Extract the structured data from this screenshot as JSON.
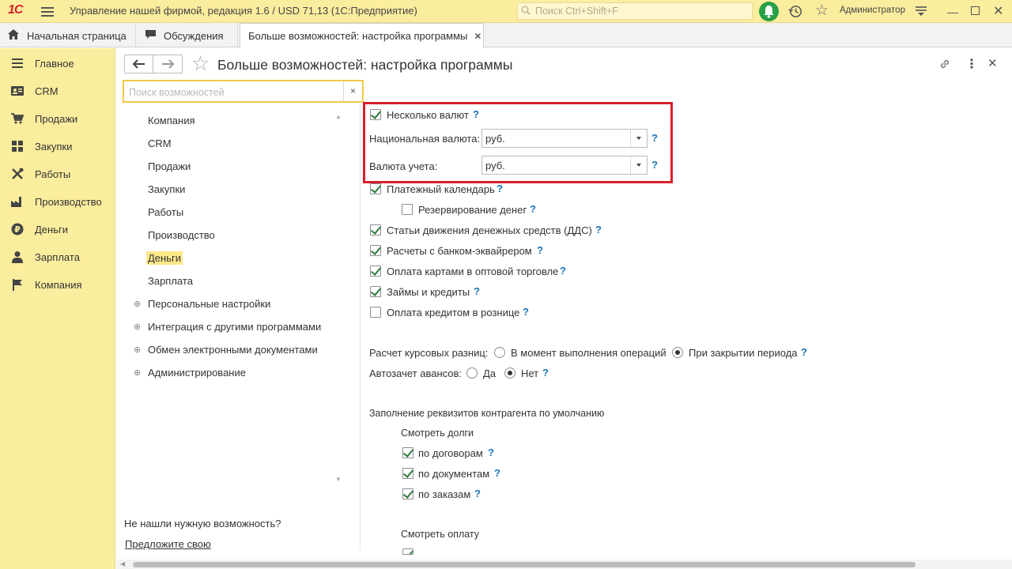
{
  "titlebar": {
    "logo": "1С",
    "app_title": "Управление нашей фирмой, редакция 1.6 / USD 71,13  (1С:Предприятие)",
    "search_placeholder": "Поиск Ctrl+Shift+F",
    "user": "Администратор"
  },
  "tabs": [
    {
      "label": "Начальная страница",
      "icon": "home-icon"
    },
    {
      "label": "Обсуждения",
      "icon": "chat-icon"
    },
    {
      "label": "Больше возможностей: настройка программы",
      "active": true
    }
  ],
  "sidebar": {
    "items": [
      {
        "label": "Главное",
        "icon": "menu-icon"
      },
      {
        "label": "CRM",
        "icon": "crm-card-icon"
      },
      {
        "label": "Продажи",
        "icon": "cart-icon"
      },
      {
        "label": "Закупки",
        "icon": "warehouse-icon"
      },
      {
        "label": "Работы",
        "icon": "tools-icon"
      },
      {
        "label": "Производство",
        "icon": "factory-icon"
      },
      {
        "label": "Деньги",
        "icon": "ruble-coin-icon"
      },
      {
        "label": "Зарплата",
        "icon": "person-icon"
      },
      {
        "label": "Компания",
        "icon": "flag-icon"
      }
    ]
  },
  "form": {
    "title": "Больше возможностей: настройка программы",
    "search_placeholder": "Поиск возможностей",
    "clear_label": "×"
  },
  "tree": {
    "items": [
      {
        "label": "Компания"
      },
      {
        "label": "CRM"
      },
      {
        "label": "Продажи"
      },
      {
        "label": "Закупки"
      },
      {
        "label": "Работы"
      },
      {
        "label": "Производство"
      },
      {
        "label": "Деньги",
        "selected": true
      },
      {
        "label": "Зарплата"
      },
      {
        "label": "Персональные настройки",
        "expandable": true
      },
      {
        "label": "Интеграция с другими программами",
        "expandable": true
      },
      {
        "label": "Обмен электронными документами",
        "expandable": true
      },
      {
        "label": "Администрирование",
        "expandable": true
      }
    ],
    "not_found": "Не нашли нужную возможность?",
    "suggest_link": "Предложите свою"
  },
  "settings": {
    "multi_currency": {
      "label": "Несколько валют",
      "checked": true
    },
    "national_currency": {
      "label": "Национальная валюта:",
      "value": "руб."
    },
    "accounting_currency": {
      "label": "Валюта учета:",
      "value": "руб."
    },
    "checkboxes": [
      {
        "label": "Платежный календарь",
        "checked": true
      },
      {
        "label": "Резервирование денег",
        "checked": false
      },
      {
        "label": "Статьи движения денежных средств (ДДС)",
        "checked": true
      },
      {
        "label": "Расчеты с банком-эквайрером",
        "checked": true
      },
      {
        "label": "Оплата картами в оптовой торговле",
        "checked": true
      },
      {
        "label": "Займы и кредиты",
        "checked": true
      },
      {
        "label": "Оплата кредитом в рознице",
        "checked": false
      }
    ],
    "exchange_diff": {
      "label": "Расчет курсовых разниц:",
      "options": [
        "В момент выполнения операций",
        "При закрытии периода"
      ],
      "selected": "При закрытии периода"
    },
    "auto_offset": {
      "label": "Автозачет авансов:",
      "options": [
        "Да",
        "Нет"
      ],
      "selected": "Нет"
    },
    "counterparty_section": "Заполнение реквизитов контрагента по умолчанию",
    "view_debts": "Смотреть долги",
    "debt_options": [
      {
        "label": "по договорам",
        "checked": true
      },
      {
        "label": "по документам",
        "checked": true
      },
      {
        "label": "по заказам",
        "checked": true
      }
    ],
    "view_payment": "Смотреть оплату",
    "help": "?"
  },
  "colors": {
    "highlight": "#d71f2b",
    "accent_yellow": "#fbed9e",
    "check_green": "#2d7b3e",
    "help_blue": "#1a73b8"
  }
}
